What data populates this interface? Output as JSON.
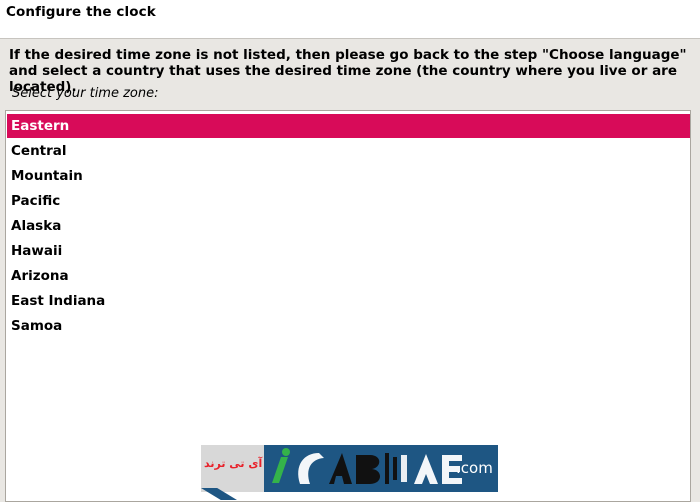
{
  "header": {
    "title": "Configure the clock"
  },
  "content": {
    "description": "If the desired time zone is not listed, then please go back to the step \"Choose language\" and select a country that uses the desired time zone (the country where you live or are located).",
    "prompt": "Select your time zone:"
  },
  "timezones": {
    "selected": "Eastern",
    "items": [
      "Eastern",
      "Central",
      "Mountain",
      "Pacific",
      "Alaska",
      "Hawaii",
      "Arizona",
      "East Indiana",
      "Samoa"
    ]
  },
  "watermark": {
    "persian_text": "آی تی ترند",
    "site_text": ".com",
    "logo_text": "iTAB"
  },
  "colors": {
    "selected_bg": "#d80b59",
    "watermark_blue": "#1e5683",
    "watermark_red": "#e8212a",
    "watermark_green": "#34b34a"
  }
}
